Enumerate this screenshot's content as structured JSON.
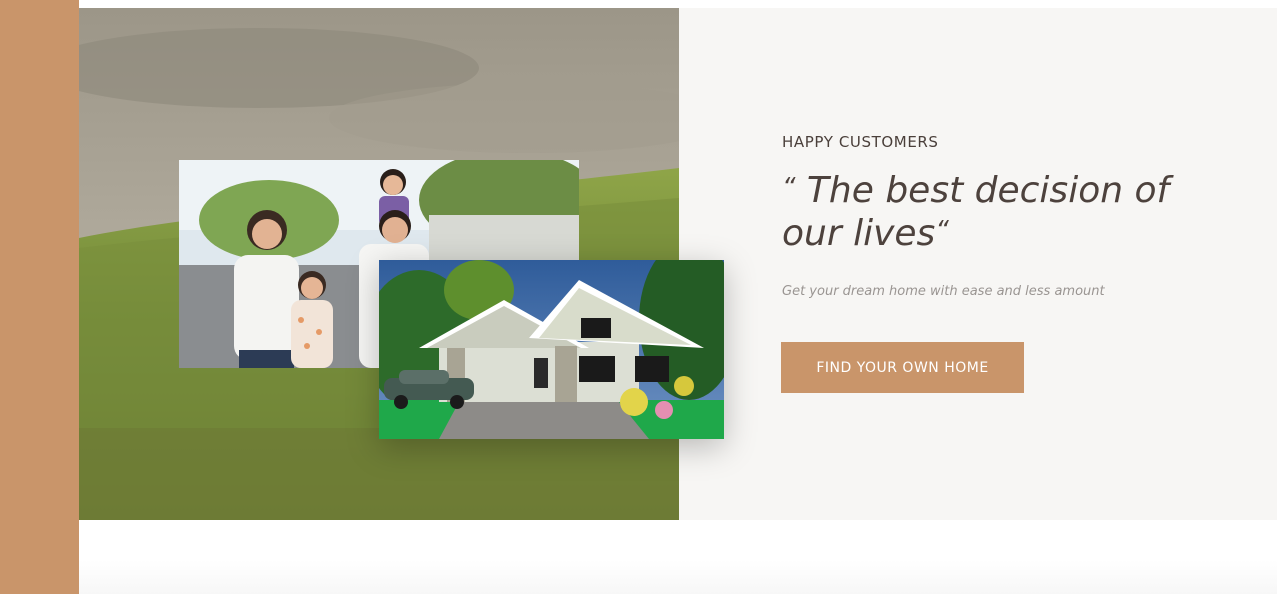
{
  "testimonial": {
    "eyebrow": "HAPPY CUSTOMERS",
    "quote_open": "“",
    "quote_text": " The best decision of our lives",
    "quote_close": "“",
    "subtext": "Get your dream home with ease and less amount",
    "cta_label": "FIND YOUR OWN HOME"
  },
  "colors": {
    "accent": "#c9956a",
    "panel_bg": "#f7f6f4",
    "heading": "#4d423d",
    "subtext": "#9a9592"
  },
  "images": {
    "background": "meadow-landscape-photo",
    "family": "happy-family-photo",
    "house": "house-render-photo"
  }
}
